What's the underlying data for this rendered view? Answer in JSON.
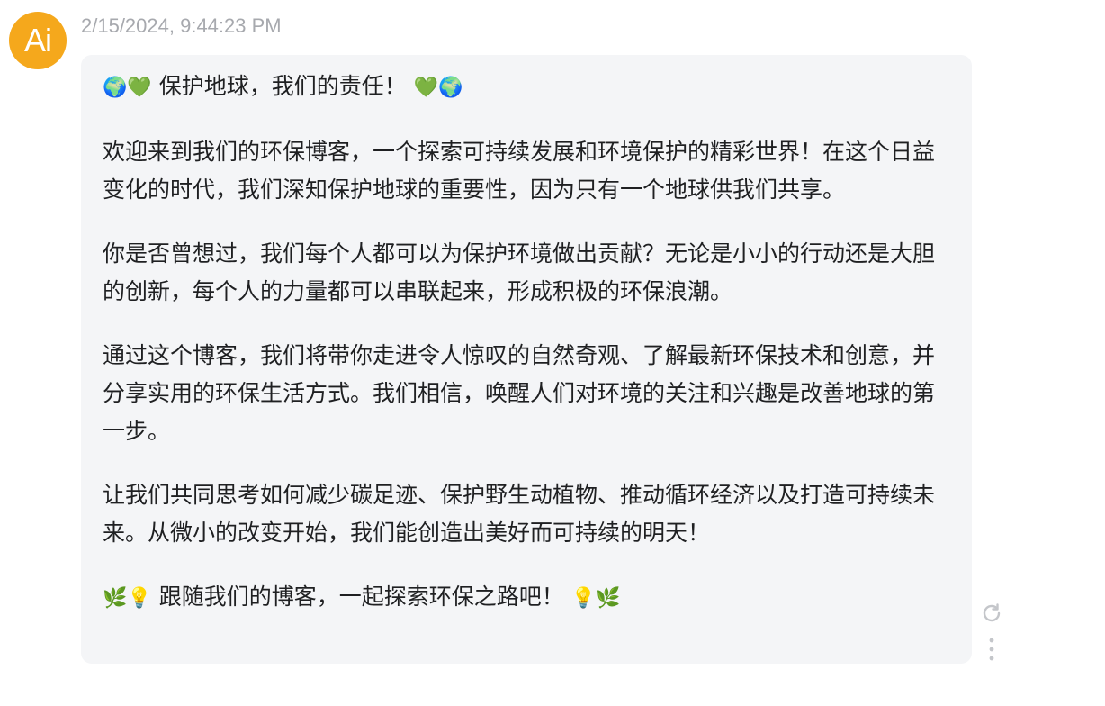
{
  "avatar": {
    "text": "Ai",
    "color": "#f5a81c"
  },
  "timestamp": "2/15/2024, 9:44:23 PM",
  "message": {
    "title_emoji_before": "🌍💚",
    "title": "保护地球，我们的责任！",
    "title_emoji_after": "💚🌍",
    "paragraph_1": "欢迎来到我们的环保博客，一个探索可持续发展和环境保护的精彩世界！在这个日益变化的时代，我们深知保护地球的重要性，因为只有一个地球供我们共享。",
    "paragraph_2": "你是否曾想过，我们每个人都可以为保护环境做出贡献？无论是小小的行动还是大胆的创新，每个人的力量都可以串联起来，形成积极的环保浪潮。",
    "paragraph_3": "通过这个博客，我们将带你走进令人惊叹的自然奇观、了解最新环保技术和创意，并分享实用的环保生活方式。我们相信，唤醒人们对环境的关注和兴趣是改善地球的第一步。",
    "paragraph_4": "让我们共同思考如何减少碳足迹、保护野生动植物、推动循环经济以及打造可持续未来。从微小的改变开始，我们能创造出美好而可持续的明天！",
    "closing_emoji_before": "🌿💡",
    "closing": "跟随我们的博客，一起探索环保之路吧！",
    "closing_emoji_after": "💡🌿"
  },
  "actions": {
    "regenerate_icon": "refresh-icon",
    "more_icon": "more-vertical-icon"
  },
  "colors": {
    "bubble_background": "#f4f5f7",
    "timestamp": "#a7a9ae",
    "icon": "#c4c6ca"
  }
}
